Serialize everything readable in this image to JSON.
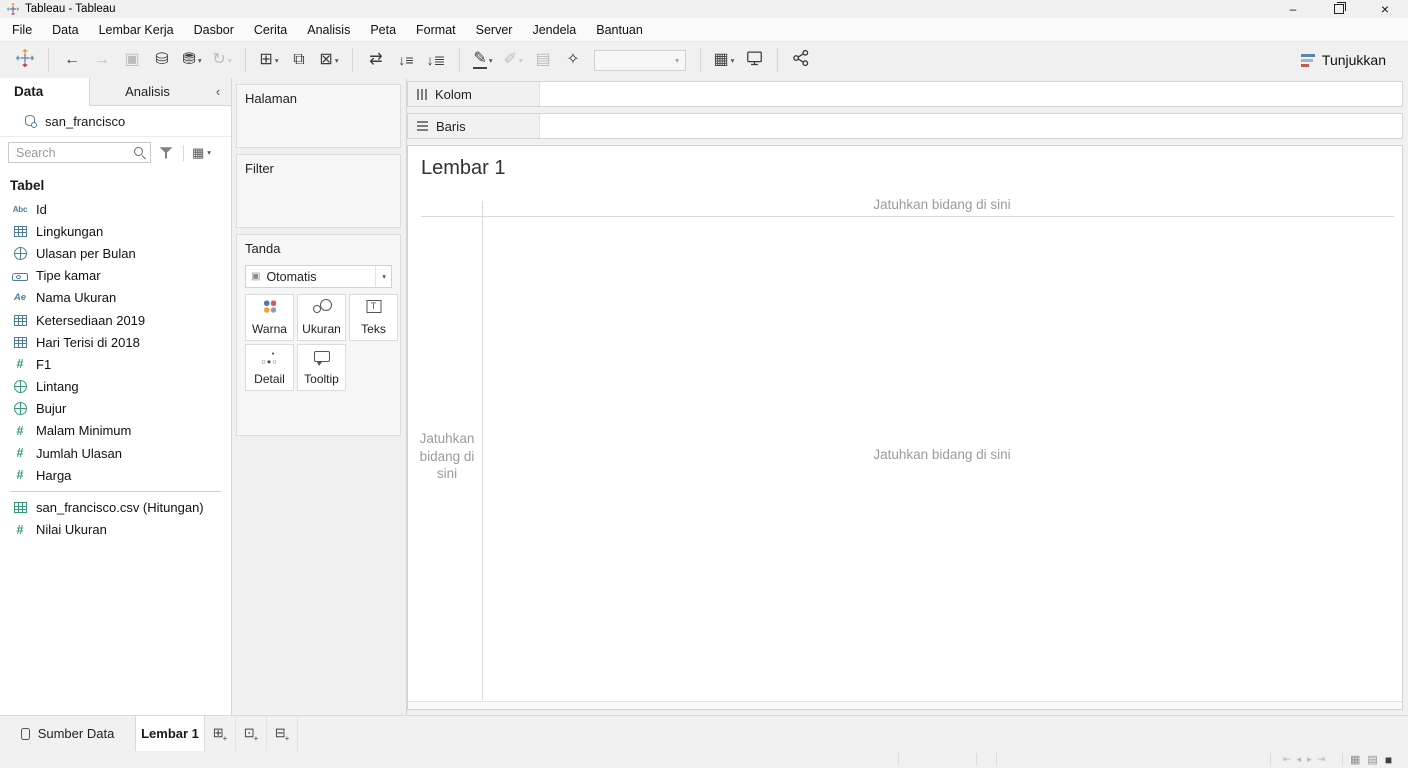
{
  "window": {
    "title": "Tableau - Tableau",
    "minimize_glyph": "–",
    "close_glyph": "×"
  },
  "menu": {
    "items": [
      "File",
      "Data",
      "Lembar Kerja",
      "Dasbor",
      "Cerita",
      "Analisis",
      "Peta",
      "Format",
      "Server",
      "Jendela",
      "Bantuan"
    ]
  },
  "toolbar": {
    "show_me_label": "Tunjukkan",
    "glyphs": {
      "undo": "←",
      "redo": "→",
      "save": "▣",
      "new_data_source": "⛁",
      "pause_updates": "⛃",
      "run_update": "↻",
      "new_worksheet": "⊞",
      "duplicate": "⧉",
      "clear_sheet": "⊠",
      "swap": "⇄",
      "sort_asc": "↓≡",
      "sort_desc": "↓≣",
      "highlight": "✎",
      "group": "✐",
      "labels": "▤",
      "fix": "✧",
      "cards": "▦",
      "caret": "▾"
    }
  },
  "sidebar": {
    "tab_data": "Data",
    "tab_analytics": "Analisis",
    "collapse_glyph": "‹",
    "datasource": "san_francisco",
    "search_placeholder": "Search",
    "grid_glyph": "▦",
    "caret_glyph": "▾",
    "section_title": "Tabel",
    "fields": [
      {
        "label": "Id",
        "icon_name": "text-field-icon",
        "icon_class": "abc dim"
      },
      {
        "label": "Lingkungan",
        "icon_name": "table-icon",
        "icon_class": "tbl dim"
      },
      {
        "label": "Ulasan per Bulan",
        "icon_name": "globe-icon",
        "icon_class": "globe dim"
      },
      {
        "label": "Tipe kamar",
        "icon_name": "bed-icon",
        "icon_class": "bed dim"
      },
      {
        "label": "Nama Ukuran",
        "icon_name": "measure-names-icon",
        "icon_class": "ae dim"
      },
      {
        "label": "Ketersediaan 2019",
        "icon_name": "table-icon",
        "icon_class": "tbl dim"
      },
      {
        "label": "Hari Terisi di 2018",
        "icon_name": "table-icon",
        "icon_class": "tbl dim"
      },
      {
        "label": "F1",
        "icon_name": "number-icon",
        "icon_class": "hash mea"
      },
      {
        "label": "Lintang",
        "icon_name": "globe-icon",
        "icon_class": "globe mea"
      },
      {
        "label": "Bujur",
        "icon_name": "globe-icon",
        "icon_class": "globe mea"
      },
      {
        "label": "Malam Minimum",
        "icon_name": "number-icon",
        "icon_class": "hash mea"
      },
      {
        "label": "Jumlah Ulasan",
        "icon_name": "number-icon",
        "icon_class": "hash mea"
      },
      {
        "label": "Harga",
        "icon_name": "number-icon",
        "icon_class": "hash mea"
      },
      {
        "label": "san_francisco.csv (Hitungan)",
        "icon_name": "table-calculation-icon",
        "icon_class": "tbl mea",
        "row_class": "sep-above"
      },
      {
        "label": "Nilai Ukuran",
        "icon_name": "number-icon",
        "icon_class": "hash mea"
      }
    ]
  },
  "cards": {
    "pages_title": "Halaman",
    "filters_title": "Filter",
    "marks_title": "Tanda",
    "mark_type": "Otomatis",
    "mark_type_glyph": "▣",
    "caret_glyph": "▾",
    "buttons": [
      {
        "label": "Warna",
        "icon_name": "color-icon",
        "icon_class": "color"
      },
      {
        "label": "Ukuran",
        "icon_name": "size-icon",
        "icon_class": "size"
      },
      {
        "label": "Teks",
        "icon_name": "text-icon",
        "icon_class": "text"
      },
      {
        "label": "Detail",
        "icon_name": "detail-icon",
        "icon_class": "detail"
      },
      {
        "label": "Tooltip",
        "icon_name": "tooltip-icon",
        "icon_class": "tooltip"
      }
    ]
  },
  "shelves": {
    "columns_label": "Kolom",
    "rows_label": "Baris"
  },
  "canvas": {
    "title": "Lembar 1",
    "drop_hint_top": "Jatuhkan bidang di sini",
    "drop_hint_left_lines": "Jatuhkan bidang di sini",
    "drop_hint_center": "Jatuhkan bidang di sini"
  },
  "sheetbar": {
    "datasource_tab": "Sumber Data",
    "sheet_tab": "Lembar 1",
    "new_buttons": [
      {
        "icon_name": "new-worksheet-icon",
        "glyph": "⊞"
      },
      {
        "icon_name": "new-dashboard-icon",
        "glyph": "⊡"
      },
      {
        "icon_name": "new-story-icon",
        "glyph": "⊟"
      }
    ]
  },
  "statusbar": {
    "nav": [
      {
        "icon_name": "first-mark-icon",
        "glyph": "⇤"
      },
      {
        "icon_name": "previous-mark-icon",
        "glyph": "◂"
      },
      {
        "icon_name": "next-mark-icon",
        "glyph": "▸"
      },
      {
        "icon_name": "last-mark-icon",
        "glyph": "⇥"
      }
    ],
    "views": [
      {
        "icon_name": "show-tabs-icon",
        "glyph": "▦",
        "cls": ""
      },
      {
        "icon_name": "show-filmstrip-icon",
        "glyph": "▤",
        "cls": ""
      },
      {
        "icon_name": "show-sheet-icon",
        "glyph": "■",
        "cls": "current"
      }
    ]
  },
  "colors": {
    "dimension_blue": "#4e7e96",
    "measure_green": "#35997c",
    "accent_blue": "#4e79a7",
    "accent_red": "#e15759",
    "accent_orange": "#f28e2b",
    "chrome_gray": "#f0f0f0"
  }
}
